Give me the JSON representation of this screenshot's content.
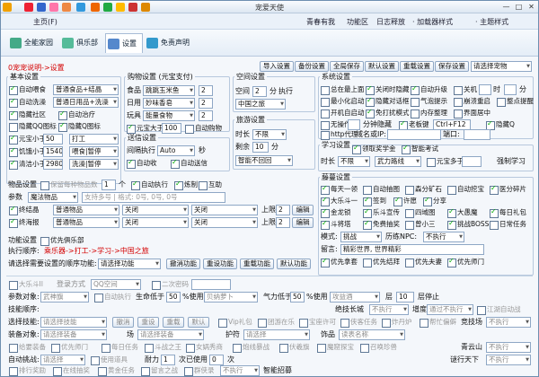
{
  "window": {
    "title": "宠爱天使",
    "min": "—",
    "max": "□",
    "close": "✕"
  },
  "menu": {
    "home": "主页(F)",
    "forum": "青春有我",
    "func": "功能区",
    "log": "日志释放",
    "plugin": "· 加载器样式",
    "theme": "· 主题样式"
  },
  "tabs": [
    {
      "label": "全能家园"
    },
    {
      "label": "俱乐部"
    },
    {
      "label": "设置"
    },
    {
      "label": "免责声明"
    }
  ],
  "top": {
    "hint": "0宠宠说明->设置",
    "buttons": [
      "导入设置",
      "备份设置",
      "全局保存",
      "默认设置",
      "重载设置",
      "保存设置"
    ],
    "profile": "请选择宠物"
  },
  "basic": {
    "title": "基本设置",
    "auto_eat": "自动喂食",
    "eat_sel": "普通食品+结晶",
    "auto_clean": "自动洗澡",
    "clean_sel": "普通日用品+洗澡",
    "hide_society": "隐藏社区",
    "auto_cure": "自动治疗",
    "hide_qq": "隐藏QQ图标",
    "hide_q": "隐藏Q图标",
    "yuanbao": "元宝小于",
    "yuanbao_val": "50",
    "work_sel": "打工",
    "food_max": "饥饿小于",
    "food_val": "1540",
    "food_sel": "喂食|暂停",
    "clean_max": "清洁小于",
    "clean_val": "2980",
    "clean_sel2": "洗澡|暂停"
  },
  "buy": {
    "title": "购物设置 (元宝支付)",
    "food_lbl": "食品",
    "food_sel": "跳跳玉米鱼",
    "food_qty": "2",
    "daily_lbl": "日用",
    "daily_sel": "妙味香皂",
    "daily_qty": "2",
    "toy_lbl": "玩具",
    "toy_sel": "能量食物",
    "toy_qty": "2",
    "yuanbao_gt": "元宝大于",
    "yuanbao_gt_val": "100",
    "auto_buy": "自动购物"
  },
  "send": {
    "title": "送信设置",
    "interval_lbl": "间隔执行",
    "interval_sel": "Auto",
    "unit": "秒",
    "auto_recv": "自动收",
    "auto_send": "自动送信"
  },
  "space": {
    "title": "空间设置",
    "space_lbl": "空间",
    "space_val": "2",
    "space_unit": "分",
    "exec": "执行",
    "space_sel": "中国之旅",
    "travel_title": "旅游设置",
    "dur_lbl": "时长",
    "dur_sel": "不限",
    "remain_lbl": "剩余",
    "remain_val": "10",
    "remain_unit": "分",
    "travel_sel": "智能不回回"
  },
  "system": {
    "title": "系统设置",
    "opts": [
      "总在最上面",
      "关闭时隐藏",
      "自动升级",
      "关机",
      "时",
      "分",
      "最小化启动",
      "隐藏对话框",
      "气泡提示",
      "崩溃重启",
      "整点提醒",
      "开机自启动",
      "免打扰模式",
      "内存整理",
      "界面居中",
      "无操作",
      "分钟隐藏",
      "老板键",
      "Ctrl+F12",
      "隐藏Q",
      "http代理",
      "域名或IP:",
      "端口:"
    ]
  },
  "study": {
    "title": "学习设置",
    "reward": "领取奖学金",
    "smart": "智能考试",
    "dur_lbl": "时长",
    "dur_sel": "不限",
    "course_sel": "武力路线",
    "yuanbao_lt": "元宝多于",
    "study_lbl": "强制学习"
  },
  "items": {
    "title": "物品设置",
    "keep": "保留每种物品数",
    "keep_val": "1",
    "unit": "个",
    "auto_exec": "自动执行",
    "make": "炼制",
    "mutual": "互助",
    "param_lbl": "参数",
    "param_sel": "魔法物品",
    "param_ph": "支持多号 | 格式: 0号, 0号, 0号",
    "sell": "终结晶",
    "sell_sel": "普通物品",
    "sell_sel2": "关闭",
    "sell_sel3": "关闭",
    "sell_limit": "上限",
    "sell_val": "2",
    "edit": "编辑",
    "fish": "终海报",
    "fish_sel": "普通物品",
    "fish_sel2": "关闭",
    "fish_sel3": "关闭",
    "fish_limit": "上限",
    "fish_val": "2",
    "edit2": "编辑"
  },
  "fight": {
    "title": "藤蔓设置",
    "opts": [
      "每天一领",
      "自动抽图",
      "森分矿石",
      "自动挖宝",
      "医分碎片",
      "大乐斗一",
      "签到",
      "许愿",
      "分享",
      "金龙锁",
      "乐斗宣传",
      "四域图",
      "大愚魔",
      "每日礼包",
      "斗将塔",
      "免费抽奖",
      "曾小三",
      "挑战BOSS",
      "日常任务"
    ],
    "mode_lbl": "模式:",
    "mode_sel": "挑战",
    "pvp_lbl": "历练NPC:",
    "pvp_sel": "不执行",
    "msg_lbl": "留言:",
    "msg_val": "精彩世界, 世界精彩",
    "sub": [
      "优先拿套",
      "优先结拜",
      "优先夫妻",
      "优先师门"
    ]
  },
  "func": {
    "title": "功能设置",
    "club": "优先俱乐部",
    "order_lbl": "执行顺序:",
    "order_val": "乘乐器->打工->学习->中国之旅",
    "pick_lbl": "请选择需要设置的顺序功能:",
    "pick_sel": "请选择功能",
    "btns": [
      "撤消功能",
      "重设功能",
      "重载功能",
      "默认功能"
    ]
  },
  "bottom": {
    "row1": [
      "大乐斗II",
      "登录方式",
      "QQ空间",
      "二次密码"
    ],
    "target_lbl": "参数对象:",
    "target_sel": "武神旗",
    "auto_exec": "自动执行",
    "hp_lbl": "生命低于",
    "hp_val": "50",
    "use": "%使用",
    "hp_sel": "贝纳萝卜",
    "mp_lbl": "气力低于",
    "mp_val": "50",
    "mp_sel": "攻益酒",
    "layer_lbl": "层",
    "layer_val": "10",
    "stop": "层停止",
    "jinxu_lbl": "技能顺序:",
    "jinxu_sel": "绝技长城",
    "exec2": "不执行",
    "dq_lbl": "增度",
    "dq_sel": "通过不执行",
    "auto_fight": "江湖自动战",
    "sel_skill_lbl": "选择技能:",
    "sel_skill_sel": "请选择技能",
    "sk_btns": [
      "撤消",
      "重设",
      "重载",
      "默认"
    ],
    "vip": "Vip礼包",
    "rows2": [
      "团游在乐",
      "宝座许可",
      "侠客任务",
      "炸丹炉",
      "帮忙偏僻",
      "竞技场"
    ],
    "arena_sel": "不执行",
    "equip_lbl": "装备对象:",
    "equip_sel": "请选择装备",
    "mail_lbl": "场",
    "mail_sel": "请选择装备",
    "task_lbl": "护符",
    "task_sel": "请选择",
    "fuse_lbl": "饰品",
    "fuse_sel": "读表名称",
    "row3": [
      "给要装备",
      "优先师门",
      "每日任务",
      "斗战之王",
      "女娲秀商",
      "炮线暴战",
      "伏羲旗",
      "魔窟探宝",
      "召唤珍兽"
    ],
    "qing": "青云山",
    "qing_sel": "不执行",
    "auto_fight2": "自动挑战:",
    "af_sel": "请选择",
    "use_fight": "使用道具",
    "weapon_lbl": "耐力",
    "weapon_val": "1",
    "exec3": "次已使用",
    "exec3_val": "0",
    "star": "次",
    "tower": "谜行天下",
    "tower_sel": "不执行",
    "row4": [
      "排行奖励",
      "在线抽奖",
      "黄金任务",
      "留言之战",
      "群侠录"
    ],
    "row4_sel": "不执行",
    "smart": "智能招募"
  },
  "colors": {
    "accent": "#3467b3",
    "red": "#d40000",
    "border": "#8ea7c5"
  }
}
